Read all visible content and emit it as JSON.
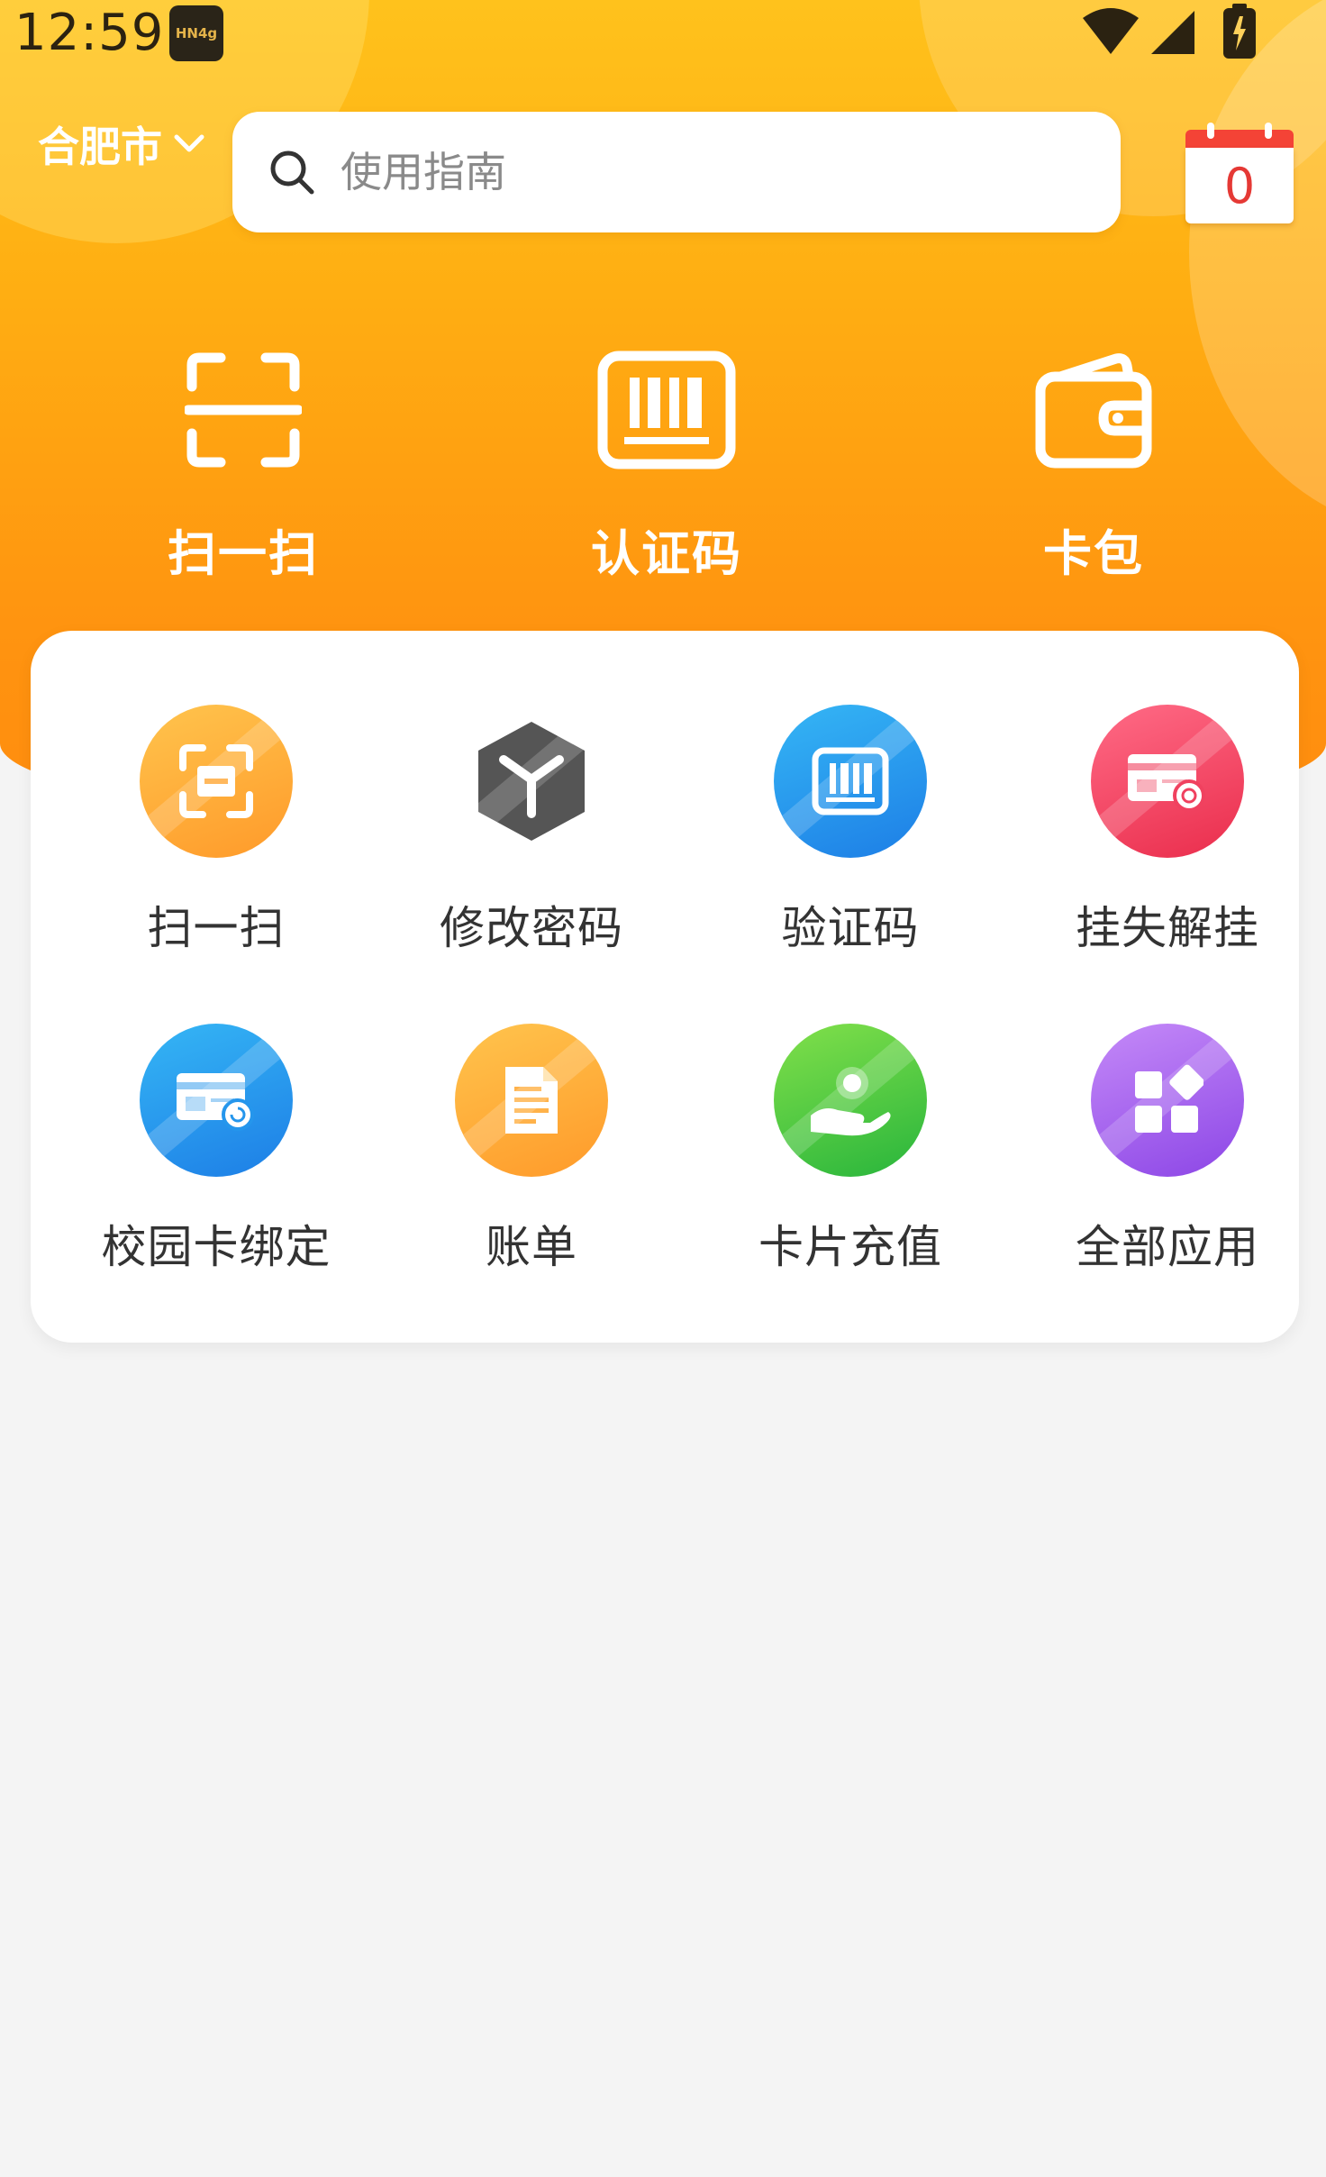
{
  "status_bar": {
    "time": "12:59",
    "notification_badge": "HN4g"
  },
  "header": {
    "city": "合肥市",
    "search_placeholder": "使用指南",
    "calendar_count": "0"
  },
  "quick_actions": [
    {
      "label": "扫一扫",
      "icon": "scan-frame-icon"
    },
    {
      "label": "认证码",
      "icon": "barcode-icon"
    },
    {
      "label": "卡包",
      "icon": "wallet-icon"
    }
  ],
  "services": [
    {
      "label": "扫一扫",
      "icon": "scan-icon",
      "color": "#ffa93a"
    },
    {
      "label": "修改密码",
      "icon": "cube-icon",
      "color": "#555555"
    },
    {
      "label": "验证码",
      "icon": "barcode-icon",
      "color": "#2596ec"
    },
    {
      "label": "挂失解挂",
      "icon": "card-lock-icon",
      "color": "#f0415f"
    },
    {
      "label": "校园卡绑定",
      "icon": "card-bind-icon",
      "color": "#2596ec"
    },
    {
      "label": "账单",
      "icon": "bill-icon",
      "color": "#ffa93a"
    },
    {
      "label": "卡片充值",
      "icon": "recharge-hand-icon",
      "color": "#3cc341"
    },
    {
      "label": "全部应用",
      "icon": "all-apps-icon",
      "color": "#a463ee"
    }
  ],
  "colors": {
    "primary": "#ff9410",
    "accent_red": "#e53935"
  }
}
